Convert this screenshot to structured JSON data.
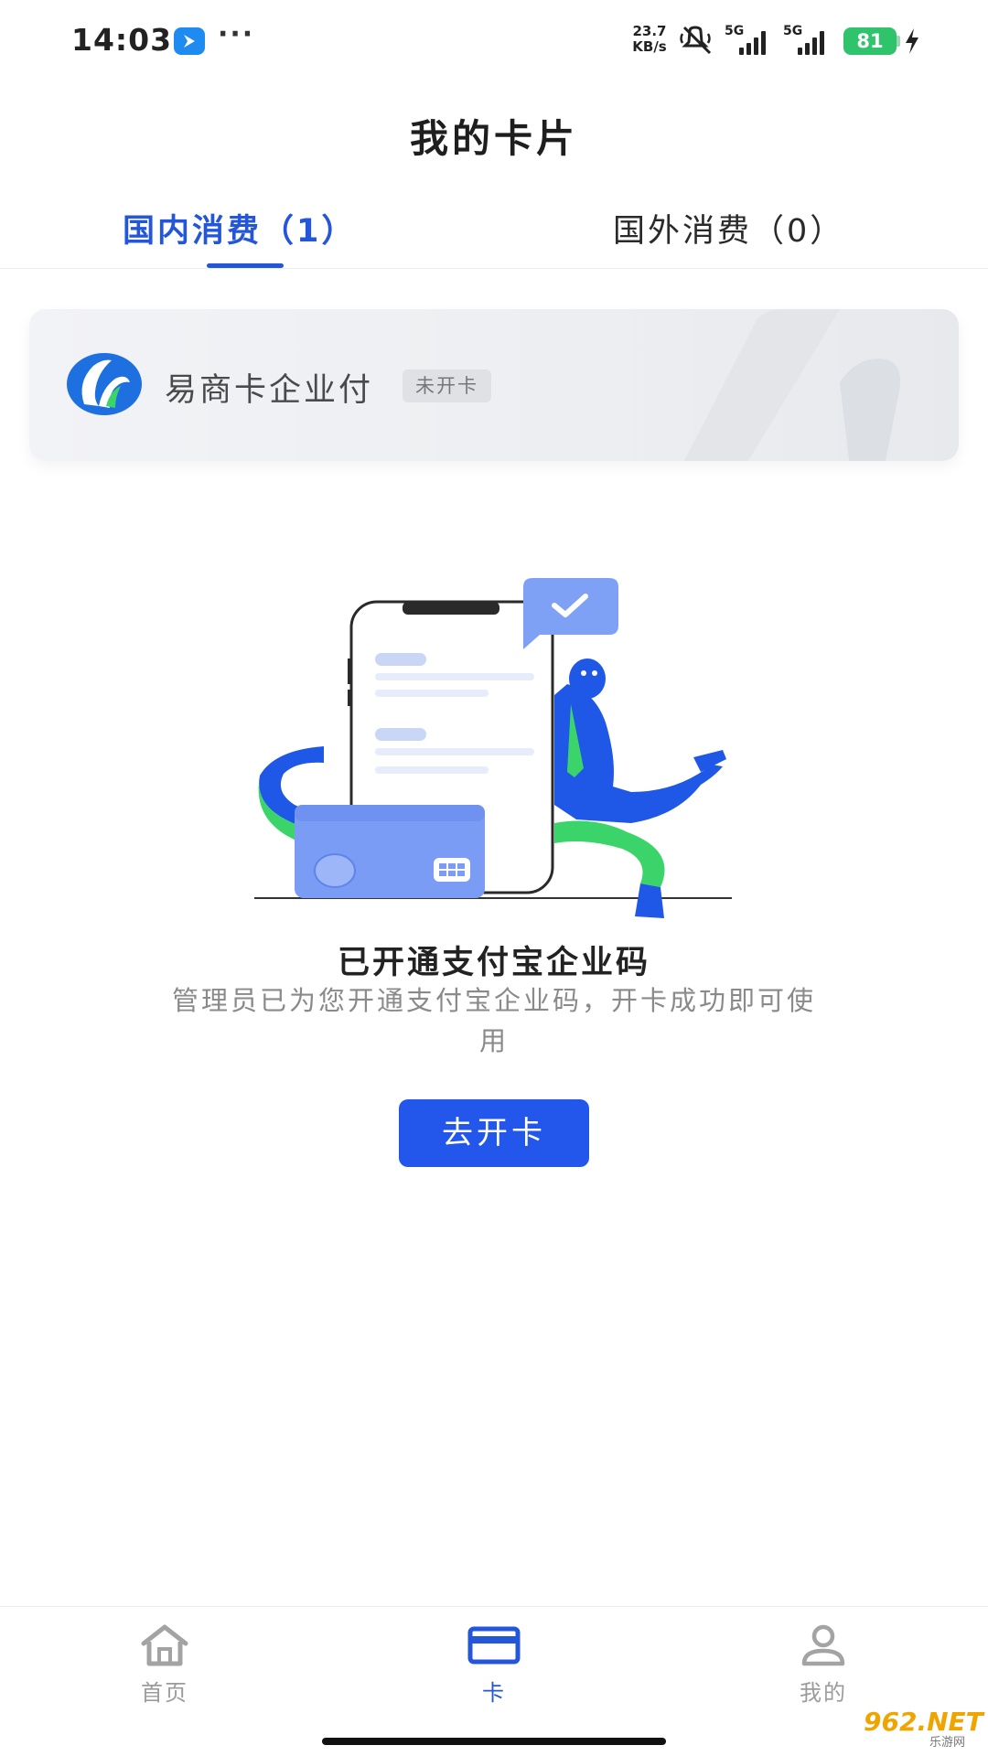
{
  "status_bar": {
    "time": "14:03",
    "net_speed_value": "23.7",
    "net_speed_unit": "KB/s",
    "signal_1_label": "5G",
    "signal_2_label": "5G",
    "battery": "81"
  },
  "header": {
    "title": "我的卡片"
  },
  "tabs": [
    {
      "label": "国内消费（1）",
      "active": true
    },
    {
      "label": "国外消费（0）",
      "active": false
    }
  ],
  "card": {
    "name": "易商卡企业付",
    "badge": "未开卡"
  },
  "empty_state": {
    "title": "已开通支付宝企业码",
    "description": "管理员已为您开通支付宝企业码，开卡成功即可使用",
    "button_label": "去开卡"
  },
  "bottom_nav": [
    {
      "label": "首页",
      "icon": "home-icon",
      "active": false
    },
    {
      "label": "卡",
      "icon": "card-icon",
      "active": true
    },
    {
      "label": "我的",
      "icon": "user-icon",
      "active": false
    }
  ],
  "watermark": {
    "main": "962.NET",
    "sub": "乐游网"
  },
  "colors": {
    "accent": "#2356d8",
    "button": "#2356ea",
    "green": "#3ad46a",
    "battery": "#2fc46b"
  }
}
